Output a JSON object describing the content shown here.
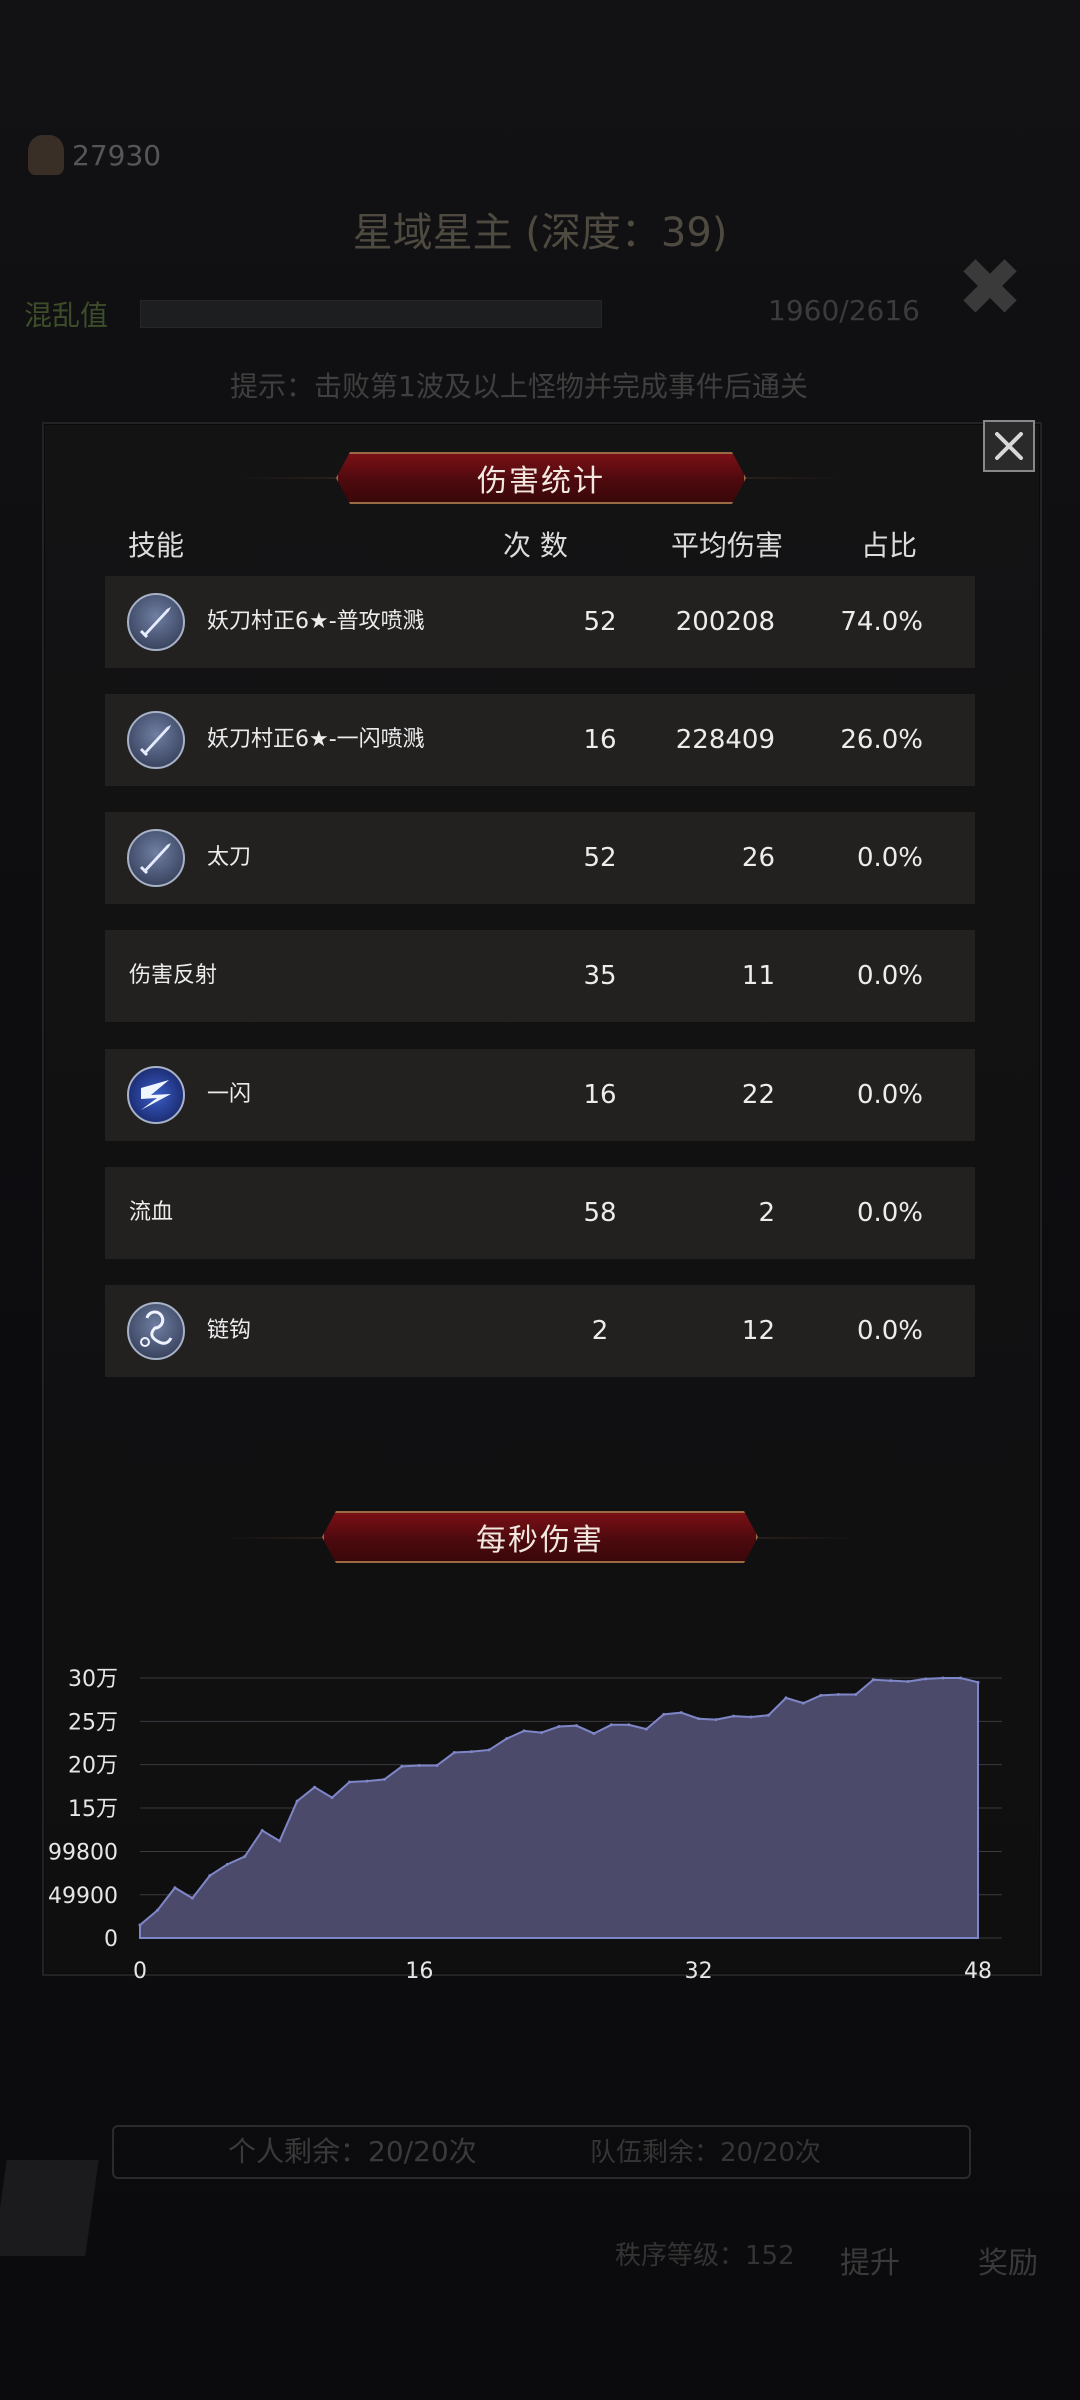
{
  "background": {
    "resource_value": "27930",
    "stage_title": "星域星主 (深度：39)",
    "chaos_label": "混乱值",
    "chaos_progress": "1960/2616",
    "hint": "提示：击败第1波及以上怪物并完成事件后通关",
    "personal_remaining": "个人剩余：20/20次",
    "team_remaining": "队伍剩余：20/20次",
    "rank_level": "秩序等级：152",
    "upgrade_label": "提升",
    "reward_label": "奖励"
  },
  "modal": {
    "title": "伤害统计",
    "columns": {
      "skill": "技能",
      "count": "次 数",
      "avg": "平均伤害",
      "ratio": "占比"
    },
    "rows": [
      {
        "name": "妖刀村正6★-普攻喷溅",
        "count": "52",
        "avg": "200208",
        "ratio": "74.0%",
        "icon": "sword-icon"
      },
      {
        "name": "妖刀村正6★-一闪喷溅",
        "count": "16",
        "avg": "228409",
        "ratio": "26.0%",
        "icon": "sword-icon"
      },
      {
        "name": "太刀",
        "count": "52",
        "avg": "26",
        "ratio": "0.0%",
        "icon": "sword-icon"
      },
      {
        "name": "伤害反射",
        "count": "35",
        "avg": "11",
        "ratio": "0.0%",
        "icon": ""
      },
      {
        "name": "一闪",
        "count": "16",
        "avg": "22",
        "ratio": "0.0%",
        "icon": "lightning-slash-icon"
      },
      {
        "name": "流血",
        "count": "58",
        "avg": "2",
        "ratio": "0.0%",
        "icon": ""
      },
      {
        "name": "链钩",
        "count": "2",
        "avg": "12",
        "ratio": "0.0%",
        "icon": "chain-hook-icon"
      }
    ],
    "dps_title": "每秒伤害"
  },
  "colors": {
    "banner_red": "#6b0d12",
    "row_bg": "#222120",
    "area_fill": "#4c4a6b",
    "area_stroke": "#7f86c8"
  },
  "chart_data": {
    "type": "area",
    "title": "每秒伤害",
    "xlabel": "",
    "ylabel": "",
    "x_ticks": [
      "0",
      "16",
      "32",
      "48"
    ],
    "y_ticks": [
      "0",
      "49900",
      "99800",
      "15万",
      "20万",
      "25万",
      "30万"
    ],
    "xlim": [
      0,
      48
    ],
    "ylim": [
      0,
      300000
    ],
    "grid": true,
    "x": [
      0,
      1,
      2,
      3,
      4,
      5,
      6,
      7,
      8,
      9,
      10,
      11,
      12,
      13,
      14,
      15,
      16,
      17,
      18,
      19,
      20,
      21,
      22,
      23,
      24,
      25,
      26,
      27,
      28,
      29,
      30,
      31,
      32,
      33,
      34,
      35,
      36,
      37,
      38,
      39,
      40,
      41,
      42,
      43,
      44,
      45,
      46,
      47,
      48
    ],
    "values": [
      15000,
      32000,
      58000,
      46000,
      72000,
      85000,
      94000,
      124000,
      112000,
      158000,
      174000,
      162000,
      180000,
      181000,
      183000,
      198000,
      199000,
      199000,
      214000,
      215000,
      217000,
      230000,
      239000,
      237000,
      244000,
      245000,
      236000,
      246000,
      246000,
      241000,
      258000,
      260000,
      253000,
      252000,
      256000,
      255000,
      257000,
      277000,
      271000,
      280000,
      281000,
      281000,
      298000,
      297000,
      296000,
      299000,
      300000,
      300000,
      295000
    ]
  }
}
